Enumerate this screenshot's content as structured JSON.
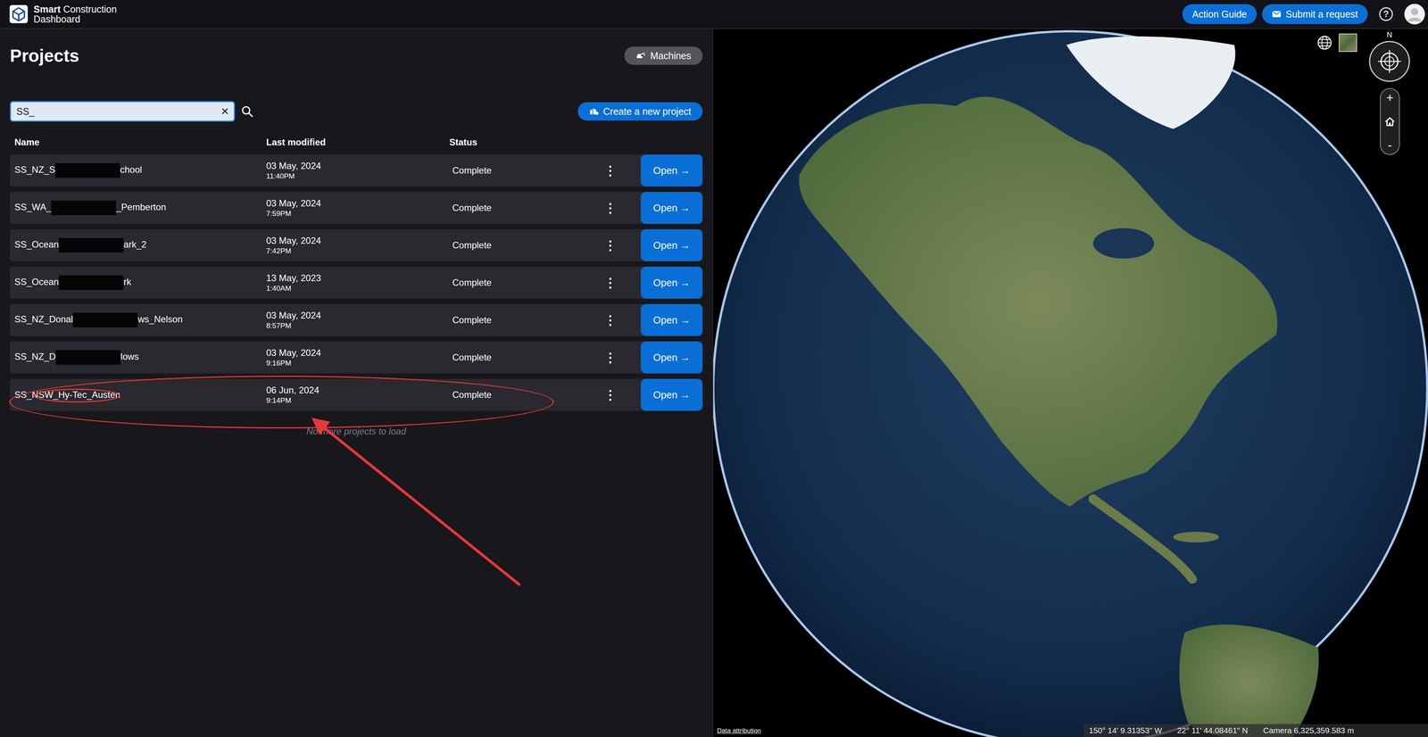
{
  "header": {
    "brand_bold": "Smart",
    "brand_rest": "Construction",
    "brand_line2": "Dashboard",
    "buttons": [
      {
        "label": "Action Guide",
        "kind": "text"
      },
      {
        "label": "Submit a request",
        "kind": "mail"
      }
    ],
    "help": "?"
  },
  "projects": {
    "title": "Projects",
    "machines_button": "Machines",
    "search": {
      "value": "SS_",
      "clear": "✕"
    },
    "create_button": "Create a new project",
    "columns": [
      "Name",
      "Last modified",
      "Status"
    ],
    "row_menu": "⋮",
    "open_button": "Open →",
    "rows": [
      {
        "name_start": "SS_NZ_S",
        "redacted": true,
        "name_end": "chool",
        "date": "03 May, 2024",
        "time": "11:40PM",
        "status": "Complete",
        "highlighted": false
      },
      {
        "name_start": "SS_WA_",
        "redacted": true,
        "name_end": "_Pemberton",
        "date": "03 May, 2024",
        "time": "7:59PM",
        "status": "Complete",
        "highlighted": false
      },
      {
        "name_start": "SS_Ocean",
        "redacted": true,
        "name_end": "ark_2",
        "date": "03 May, 2024",
        "time": "7:42PM",
        "status": "Complete",
        "highlighted": false
      },
      {
        "name_start": "SS_Ocean",
        "redacted": true,
        "name_end": "rk",
        "date": "13 May, 2023",
        "time": "1:40AM",
        "status": "Complete",
        "highlighted": false
      },
      {
        "name_start": "SS_NZ_Donal",
        "redacted": true,
        "name_end": "ws_Nelson",
        "date": "03 May, 2024",
        "time": "8:57PM",
        "status": "Complete",
        "highlighted": false
      },
      {
        "name_start": "SS_NZ_D",
        "redacted": true,
        "name_end": "lows",
        "date": "03 May, 2024",
        "time": "9:16PM",
        "status": "Complete",
        "highlighted": false
      },
      {
        "name_start": "SS_NSW_Hy-Tec_Austen",
        "redacted": false,
        "name_end": "",
        "date": "06 Jun, 2024",
        "time": "9:14PM",
        "status": "Complete",
        "highlighted": true
      }
    ],
    "footer": "No more projects to load"
  },
  "map": {
    "compass": "N",
    "zoom_in": "+",
    "zoom_out": "-",
    "longitude": "150° 14' 9.31353\" W",
    "latitude": "22° 11' 44.08461\" N",
    "camera": "Camera 6,325,359.583 m",
    "attribution": "Data attribution"
  }
}
